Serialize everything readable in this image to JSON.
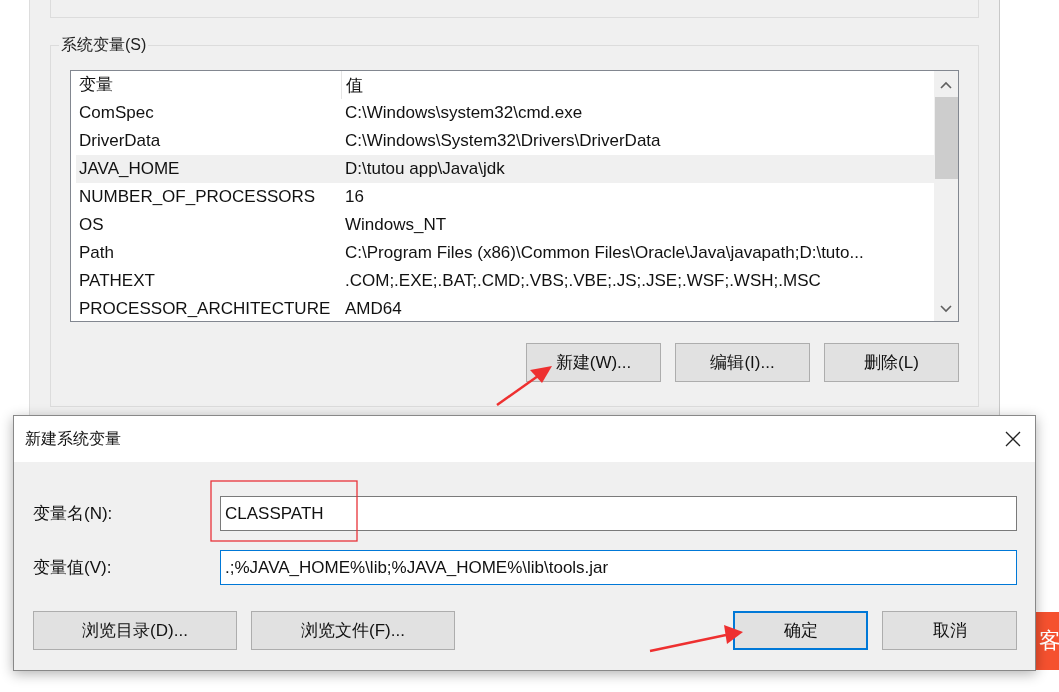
{
  "background_dialog": {
    "group_title": "系统变量(S)",
    "columns": [
      "变量",
      "值"
    ],
    "rows": [
      {
        "name": "ComSpec",
        "value": "C:\\Windows\\system32\\cmd.exe",
        "selected": false
      },
      {
        "name": "DriverData",
        "value": "C:\\Windows\\System32\\Drivers\\DriverData",
        "selected": false
      },
      {
        "name": "JAVA_HOME",
        "value": "D:\\tutou app\\Java\\jdk",
        "selected": true
      },
      {
        "name": "NUMBER_OF_PROCESSORS",
        "value": "16",
        "selected": false
      },
      {
        "name": "OS",
        "value": "Windows_NT",
        "selected": false
      },
      {
        "name": "Path",
        "value": "C:\\Program Files (x86)\\Common Files\\Oracle\\Java\\javapath;D:\\tuto...",
        "selected": false
      },
      {
        "name": "PATHEXT",
        "value": ".COM;.EXE;.BAT;.CMD;.VBS;.VBE;.JS;.JSE;.WSF;.WSH;.MSC",
        "selected": false
      },
      {
        "name": "PROCESSOR_ARCHITECTURE",
        "value": "AMD64",
        "selected": false
      }
    ],
    "buttons": [
      "新建(W)...",
      "编辑(I)...",
      "删除(L)"
    ]
  },
  "side_badge": "客",
  "dialog": {
    "title": "新建系统变量",
    "fields": [
      {
        "label": "变量名(N):",
        "value": "CLASSPATH",
        "focused": false
      },
      {
        "label": "变量值(V):",
        "value": ".;%JAVA_HOME%\\lib;%JAVA_HOME%\\lib\\tools.jar",
        "focused": true
      }
    ],
    "buttons": [
      {
        "label": "浏览目录(D)...",
        "default": false
      },
      {
        "label": "浏览文件(F)...",
        "default": false
      },
      {
        "label": "确定",
        "default": true
      },
      {
        "label": "取消",
        "default": false
      }
    ]
  }
}
